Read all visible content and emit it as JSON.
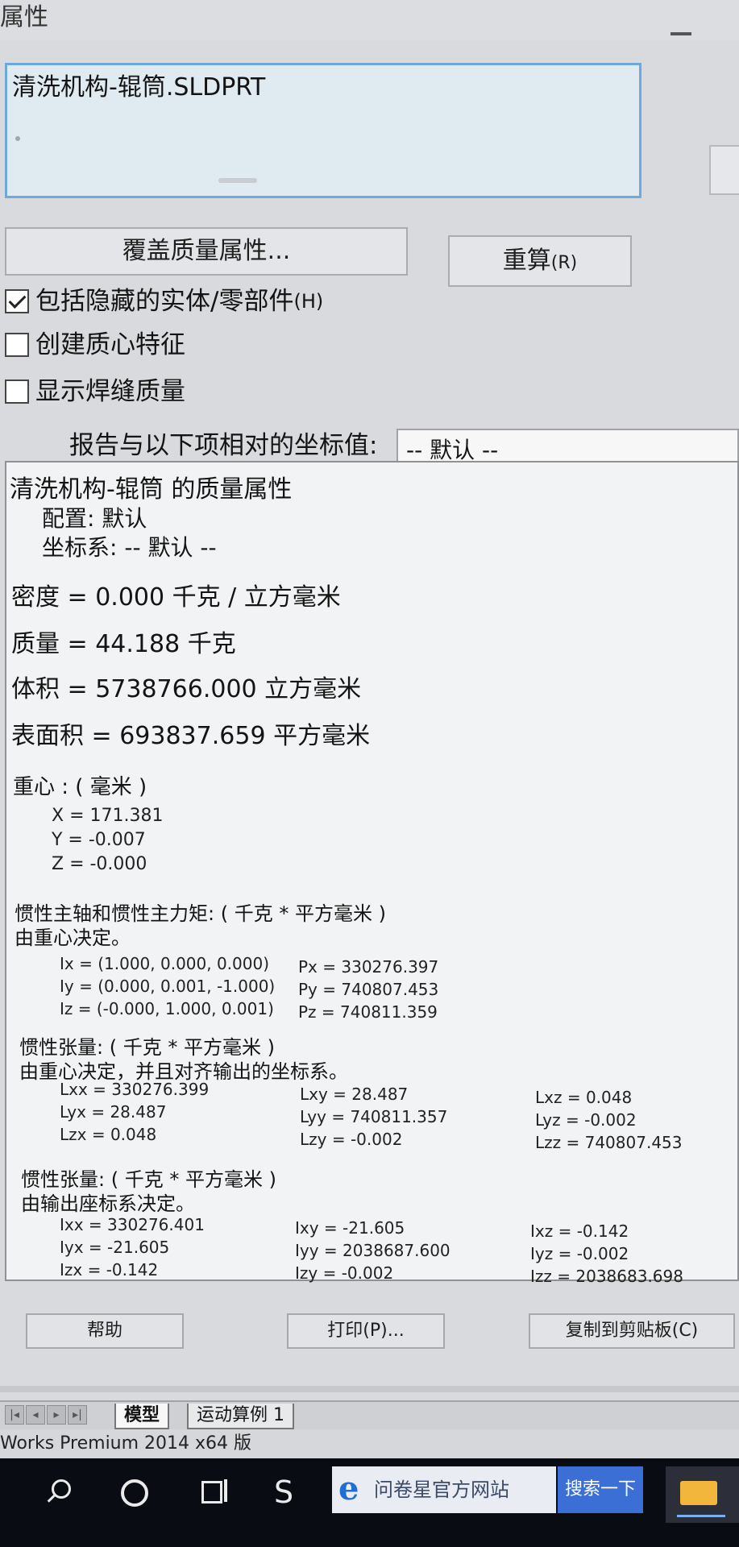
{
  "window": {
    "title": "属性"
  },
  "selection": {
    "file_name": "清洗机构-辊筒.SLDPRT"
  },
  "buttons": {
    "override": "覆盖质量属性...",
    "recalculate": "重算",
    "recalculate_accel": "(R)",
    "help": "帮助",
    "print": "打印(P)...",
    "copy": "复制到剪贴板(C)"
  },
  "options": {
    "include_hidden": {
      "label": "包括隐藏的实体/零部件",
      "accel": "(H)",
      "checked": true
    },
    "create_com": {
      "label": "创建质心特征",
      "checked": false
    },
    "show_weld": {
      "label": "显示焊缝质量",
      "checked": false
    }
  },
  "coord": {
    "label": "报告与以下项相对的坐标值:",
    "selected": "-- 默认 --"
  },
  "results": {
    "heading": "清洗机构-辊筒 的质量属性",
    "config": "配置:  默认",
    "coord_sys": "坐标系:  -- 默认 --",
    "density": "密度 = 0.000 千克 / 立方毫米",
    "mass": "质量 = 44.188 千克",
    "volume": "体积 = 5738766.000 立方毫米",
    "surface": "表面积 = 693837.659  平方毫米",
    "com_heading": "重心 : ( 毫米 )",
    "com_x": "X = 171.381",
    "com_y": "Y = -0.007",
    "com_z": "Z = -0.000",
    "principal_heading": "惯性主轴和惯性主力矩: ( 千克 *  平方毫米 )",
    "principal_sub": "由重心决定。",
    "ix": "Ix = (1.000, 0.000, 0.000)",
    "iy": "Iy = (0.000, 0.001, -1.000)",
    "iz": "Iz = (-0.000, 1.000, 0.001)",
    "px": "Px = 330276.397",
    "py": "Py = 740807.453",
    "pz": "Pz = 740811.359",
    "tensor_com_heading": "惯性张量: ( 千克 *  平方毫米 )",
    "tensor_com_sub": "由重心决定，并且对齐输出的坐标系。",
    "lxx": "Lxx = 330276.399",
    "lxy": "Lxy = 28.487",
    "lxz": "Lxz = 0.048",
    "lyx": "Lyx = 28.487",
    "lyy": "Lyy = 740811.357",
    "lyz": "Lyz = -0.002",
    "lzx": "Lzx = 0.048",
    "lzy": "Lzy = -0.002",
    "lzz": "Lzz = 740807.453",
    "tensor_out_heading": "惯性张量: ( 千克 *  平方毫米 )",
    "tensor_out_sub": "由输出座标系决定。",
    "ixx": "Ixx = 330276.401",
    "ixy": "Ixy = -21.605",
    "ixz": "Ixz = -0.142",
    "iyx": "Iyx = -21.605",
    "iyy": "Iyy = 2038687.600",
    "iyz": "Iyz = -0.002",
    "izx": "Izx = -0.142",
    "izy": "Izy = -0.002",
    "izz": "Izz = 2038683.698"
  },
  "tabs": [
    {
      "label": "模型"
    },
    {
      "label": "运动算例 1"
    }
  ],
  "status": {
    "text": "Works Premium 2014 x64 版"
  },
  "taskbar": {
    "app_glyph": "S",
    "ie_glyph": "e",
    "ie_text": "问卷星官方网站",
    "search_button": "搜索一下"
  }
}
